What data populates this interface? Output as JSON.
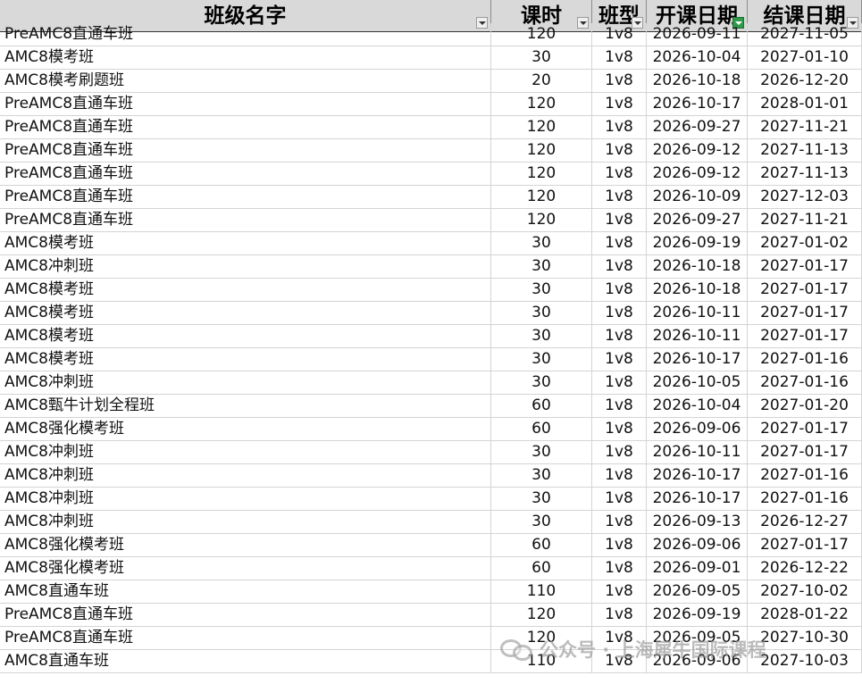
{
  "headers": {
    "name": "班级名字",
    "hours": "课时",
    "type": "班型",
    "start": "开课日期",
    "end": "结课日期"
  },
  "rows": [
    [
      "PreAMC8直通车班",
      "120",
      "1v8",
      "2026-09-11",
      "2027-11-05"
    ],
    [
      "AMC8模考班",
      "30",
      "1v8",
      "2026-10-04",
      "2027-01-10"
    ],
    [
      "AMC8模考刷题班",
      "20",
      "1v8",
      "2026-10-18",
      "2026-12-20"
    ],
    [
      "PreAMC8直通车班",
      "120",
      "1v8",
      "2026-10-17",
      "2028-01-01"
    ],
    [
      "PreAMC8直通车班",
      "120",
      "1v8",
      "2026-09-27",
      "2027-11-21"
    ],
    [
      "PreAMC8直通车班",
      "120",
      "1v8",
      "2026-09-12",
      "2027-11-13"
    ],
    [
      "PreAMC8直通车班",
      "120",
      "1v8",
      "2026-09-12",
      "2027-11-13"
    ],
    [
      "PreAMC8直通车班",
      "120",
      "1v8",
      "2026-10-09",
      "2027-12-03"
    ],
    [
      "PreAMC8直通车班",
      "120",
      "1v8",
      "2026-09-27",
      "2027-11-21"
    ],
    [
      "AMC8模考班",
      "30",
      "1v8",
      "2026-09-19",
      "2027-01-02"
    ],
    [
      "AMC8冲刺班",
      "30",
      "1v8",
      "2026-10-18",
      "2027-01-17"
    ],
    [
      "AMC8模考班",
      "30",
      "1v8",
      "2026-10-18",
      "2027-01-17"
    ],
    [
      "AMC8模考班",
      "30",
      "1v8",
      "2026-10-11",
      "2027-01-17"
    ],
    [
      "AMC8模考班",
      "30",
      "1v8",
      "2026-10-11",
      "2027-01-17"
    ],
    [
      "AMC8模考班",
      "30",
      "1v8",
      "2026-10-17",
      "2027-01-16"
    ],
    [
      "AMC8冲刺班",
      "30",
      "1v8",
      "2026-10-05",
      "2027-01-16"
    ],
    [
      "AMC8甄牛计划全程班",
      "60",
      "1v8",
      "2026-10-04",
      "2027-01-20"
    ],
    [
      "AMC8强化模考班",
      "60",
      "1v8",
      "2026-09-06",
      "2027-01-17"
    ],
    [
      "AMC8冲刺班",
      "30",
      "1v8",
      "2026-10-11",
      "2027-01-17"
    ],
    [
      "AMC8冲刺班",
      "30",
      "1v8",
      "2026-10-17",
      "2027-01-16"
    ],
    [
      "AMC8冲刺班",
      "30",
      "1v8",
      "2026-10-17",
      "2027-01-16"
    ],
    [
      "AMC8冲刺班",
      "30",
      "1v8",
      "2026-09-13",
      "2026-12-27"
    ],
    [
      "AMC8强化模考班",
      "60",
      "1v8",
      "2026-09-06",
      "2027-01-17"
    ],
    [
      "AMC8强化模考班",
      "60",
      "1v8",
      "2026-09-01",
      "2026-12-22"
    ],
    [
      "AMC8直通车班",
      "110",
      "1v8",
      "2026-09-05",
      "2027-10-02"
    ],
    [
      "PreAMC8直通车班",
      "120",
      "1v8",
      "2026-09-19",
      "2028-01-22"
    ],
    [
      "PreAMC8直通车班",
      "120",
      "1v8",
      "2026-09-05",
      "2027-10-30"
    ],
    [
      "AMC8直通车班",
      "110",
      "1v8",
      "2026-09-06",
      "2027-10-03"
    ]
  ],
  "watermark": {
    "text": "公众号 · 上海犀牛国际课程",
    "icon": "wechat-icon"
  },
  "colors": {
    "header_bg": "#d9d9d9",
    "active_filter": "#2e9a4a",
    "grid": "#d4d4d4"
  }
}
